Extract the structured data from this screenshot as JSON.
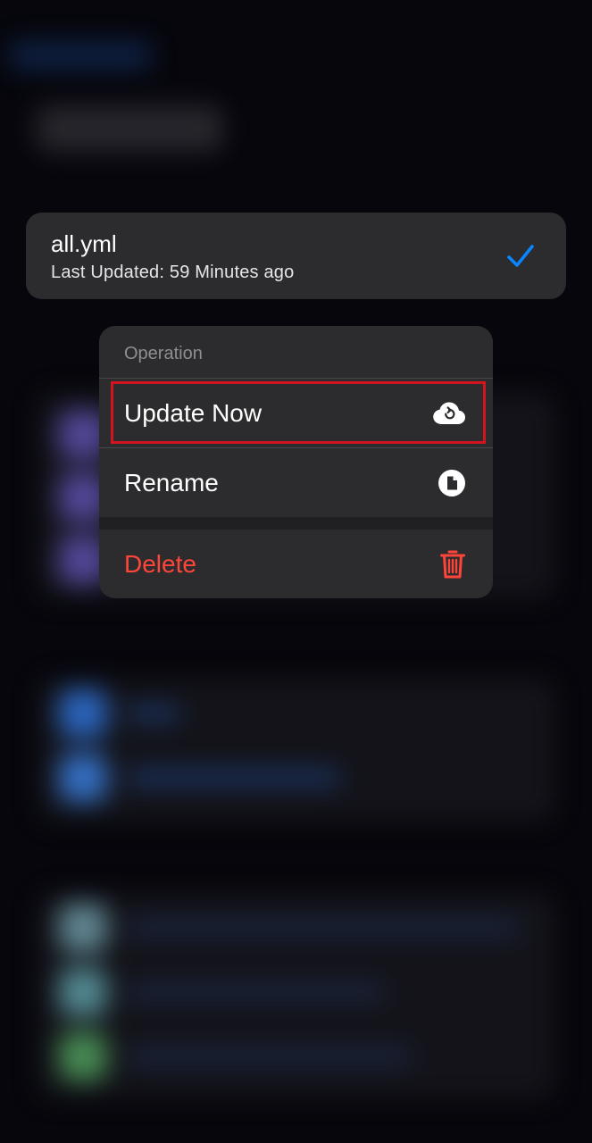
{
  "config": {
    "name": "all.yml",
    "subtitle": "Last Updated: 59 Minutes ago",
    "selected": true
  },
  "menu": {
    "header": "Operation",
    "items": [
      {
        "label": "Update Now",
        "icon": "cloud-refresh-icon"
      },
      {
        "label": "Rename",
        "icon": "document-icon"
      },
      {
        "label": "Delete",
        "icon": "trash-icon",
        "destructive": true
      }
    ],
    "highlighted": "Update Now"
  },
  "colors": {
    "accent": "#0a84ff",
    "destructive": "#ff453a",
    "highlight_border": "#d2141e",
    "card_bg": "#2c2c2e",
    "secondary_text": "#8e8e93"
  }
}
